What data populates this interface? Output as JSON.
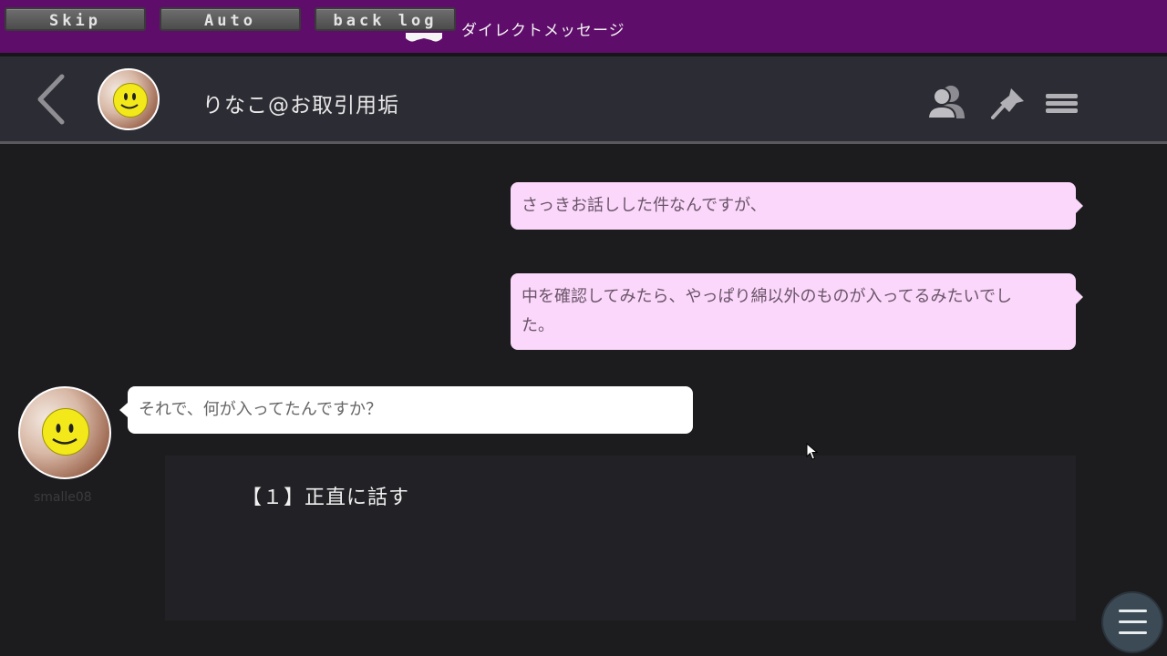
{
  "system_buttons": {
    "skip": "Skip",
    "auto": "Auto",
    "backlog": "back log"
  },
  "screen_title": "ダイレクトメッセージ",
  "header": {
    "contact_name": "りなこ@お取引用垢",
    "icons": [
      "back-arrow-icon",
      "profile-icon",
      "pin-icon",
      "hamburger-icon"
    ]
  },
  "messages": [
    {
      "side": "outgoing",
      "text_lines": [
        "さっきお話しした件なんですが、"
      ]
    },
    {
      "side": "outgoing",
      "text_lines": [
        "中を確認してみたら、やっぱり綿以外のものが入ってるみたいでし",
        "た。"
      ]
    },
    {
      "side": "incoming",
      "sender": "smalle08",
      "text_lines": [
        "それで、何が入ってたんですか？"
      ]
    }
  ],
  "choices": [
    "【１】正直に話す"
  ],
  "colors": {
    "top_bar": "#5f0d6a",
    "outgoing_bubble": "#fbd8fb",
    "incoming_bubble": "#ffffff",
    "background": "#1c1c1f"
  }
}
